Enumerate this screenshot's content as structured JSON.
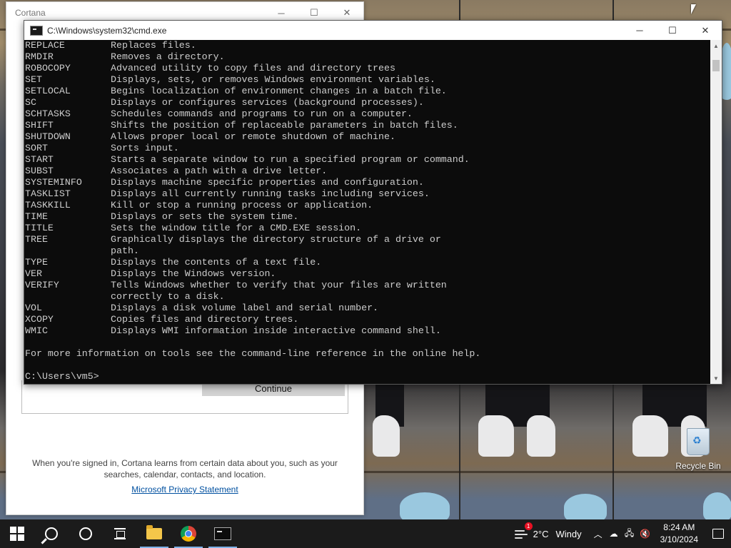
{
  "cortana": {
    "title": "Cortana",
    "continue_label": "Continue",
    "info_line1": "When you're signed in, Cortana learns from certain data about you, such as your",
    "info_line2": "searches, calendar, contacts, and location.",
    "privacy_link": "Microsoft Privacy Statement"
  },
  "cmd": {
    "title": "C:\\Windows\\system32\\cmd.exe",
    "lines": [
      [
        "REPLACE",
        "Replaces files."
      ],
      [
        "RMDIR",
        "Removes a directory."
      ],
      [
        "ROBOCOPY",
        "Advanced utility to copy files and directory trees"
      ],
      [
        "SET",
        "Displays, sets, or removes Windows environment variables."
      ],
      [
        "SETLOCAL",
        "Begins localization of environment changes in a batch file."
      ],
      [
        "SC",
        "Displays or configures services (background processes)."
      ],
      [
        "SCHTASKS",
        "Schedules commands and programs to run on a computer."
      ],
      [
        "SHIFT",
        "Shifts the position of replaceable parameters in batch files."
      ],
      [
        "SHUTDOWN",
        "Allows proper local or remote shutdown of machine."
      ],
      [
        "SORT",
        "Sorts input."
      ],
      [
        "START",
        "Starts a separate window to run a specified program or command."
      ],
      [
        "SUBST",
        "Associates a path with a drive letter."
      ],
      [
        "SYSTEMINFO",
        "Displays machine specific properties and configuration."
      ],
      [
        "TASKLIST",
        "Displays all currently running tasks including services."
      ],
      [
        "TASKKILL",
        "Kill or stop a running process or application."
      ],
      [
        "TIME",
        "Displays or sets the system time."
      ],
      [
        "TITLE",
        "Sets the window title for a CMD.EXE session."
      ],
      [
        "TREE",
        "Graphically displays the directory structure of a drive or"
      ],
      [
        "",
        "path."
      ],
      [
        "TYPE",
        "Displays the contents of a text file."
      ],
      [
        "VER",
        "Displays the Windows version."
      ],
      [
        "VERIFY",
        "Tells Windows whether to verify that your files are written"
      ],
      [
        "",
        "correctly to a disk."
      ],
      [
        "VOL",
        "Displays a disk volume label and serial number."
      ],
      [
        "XCOPY",
        "Copies files and directory trees."
      ],
      [
        "WMIC",
        "Displays WMI information inside interactive command shell."
      ],
      [
        "",
        ""
      ],
      [
        "For more information on tools see the command-line reference in the online help.",
        ""
      ],
      [
        "",
        ""
      ],
      [
        "C:\\Users\\vm5>",
        ""
      ]
    ]
  },
  "desktop": {
    "recycle_bin_label": "Recycle Bin"
  },
  "taskbar": {
    "start_icon": "windows-logo-icon",
    "search_icon": "search-icon",
    "cortana_icon": "cortana-circle-icon",
    "taskview_icon": "task-view-icon",
    "pinned": [
      "file-explorer-icon",
      "chrome-icon",
      "cmd-icon"
    ],
    "weather_temp": "2°C",
    "weather_text": "Windy",
    "weather_badge": "1",
    "time": "8:24 AM",
    "date": "3/10/2024"
  },
  "colors": {
    "console_bg": "#0c0c0c",
    "console_fg": "#cccccc",
    "taskbar_bg": "#1b1b1b",
    "link": "#0050a0"
  }
}
